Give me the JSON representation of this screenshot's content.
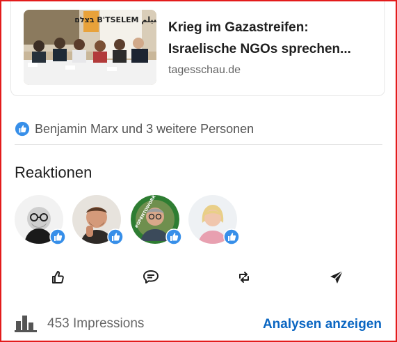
{
  "article": {
    "title": "Krieg im Gazastreifen: Israelische NGOs sprechen...",
    "source": "tagesschau.de",
    "thumbnail_logo_text": "בצלם B'TSELEM بتسيلم"
  },
  "reactions_summary": {
    "text": "Benjamin Marx und 3 weitere Personen",
    "icon": "like-icon"
  },
  "reactions": {
    "heading": "Reaktionen",
    "reactors": [
      {
        "name": "avatar-1",
        "badge": "like-icon"
      },
      {
        "name": "avatar-2",
        "badge": "like-icon"
      },
      {
        "name": "avatar-3",
        "badge": "like-icon",
        "ring_text": "#OPENTOWORK"
      },
      {
        "name": "avatar-4",
        "badge": "like-icon"
      }
    ]
  },
  "actions": [
    {
      "name": "like-button",
      "icon": "thumbs-up-icon"
    },
    {
      "name": "comment-button",
      "icon": "comment-icon"
    },
    {
      "name": "repost-button",
      "icon": "repost-icon"
    },
    {
      "name": "send-button",
      "icon": "send-icon"
    }
  ],
  "footer": {
    "impressions_text": "453 Impressions",
    "analytics_link": "Analysen anzeigen",
    "icon": "bar-chart-icon"
  },
  "colors": {
    "accent": "#0a66c2",
    "like_badge": "#378fe9",
    "frame": "#e31b1b",
    "open_to_work": "#2e7d32"
  }
}
